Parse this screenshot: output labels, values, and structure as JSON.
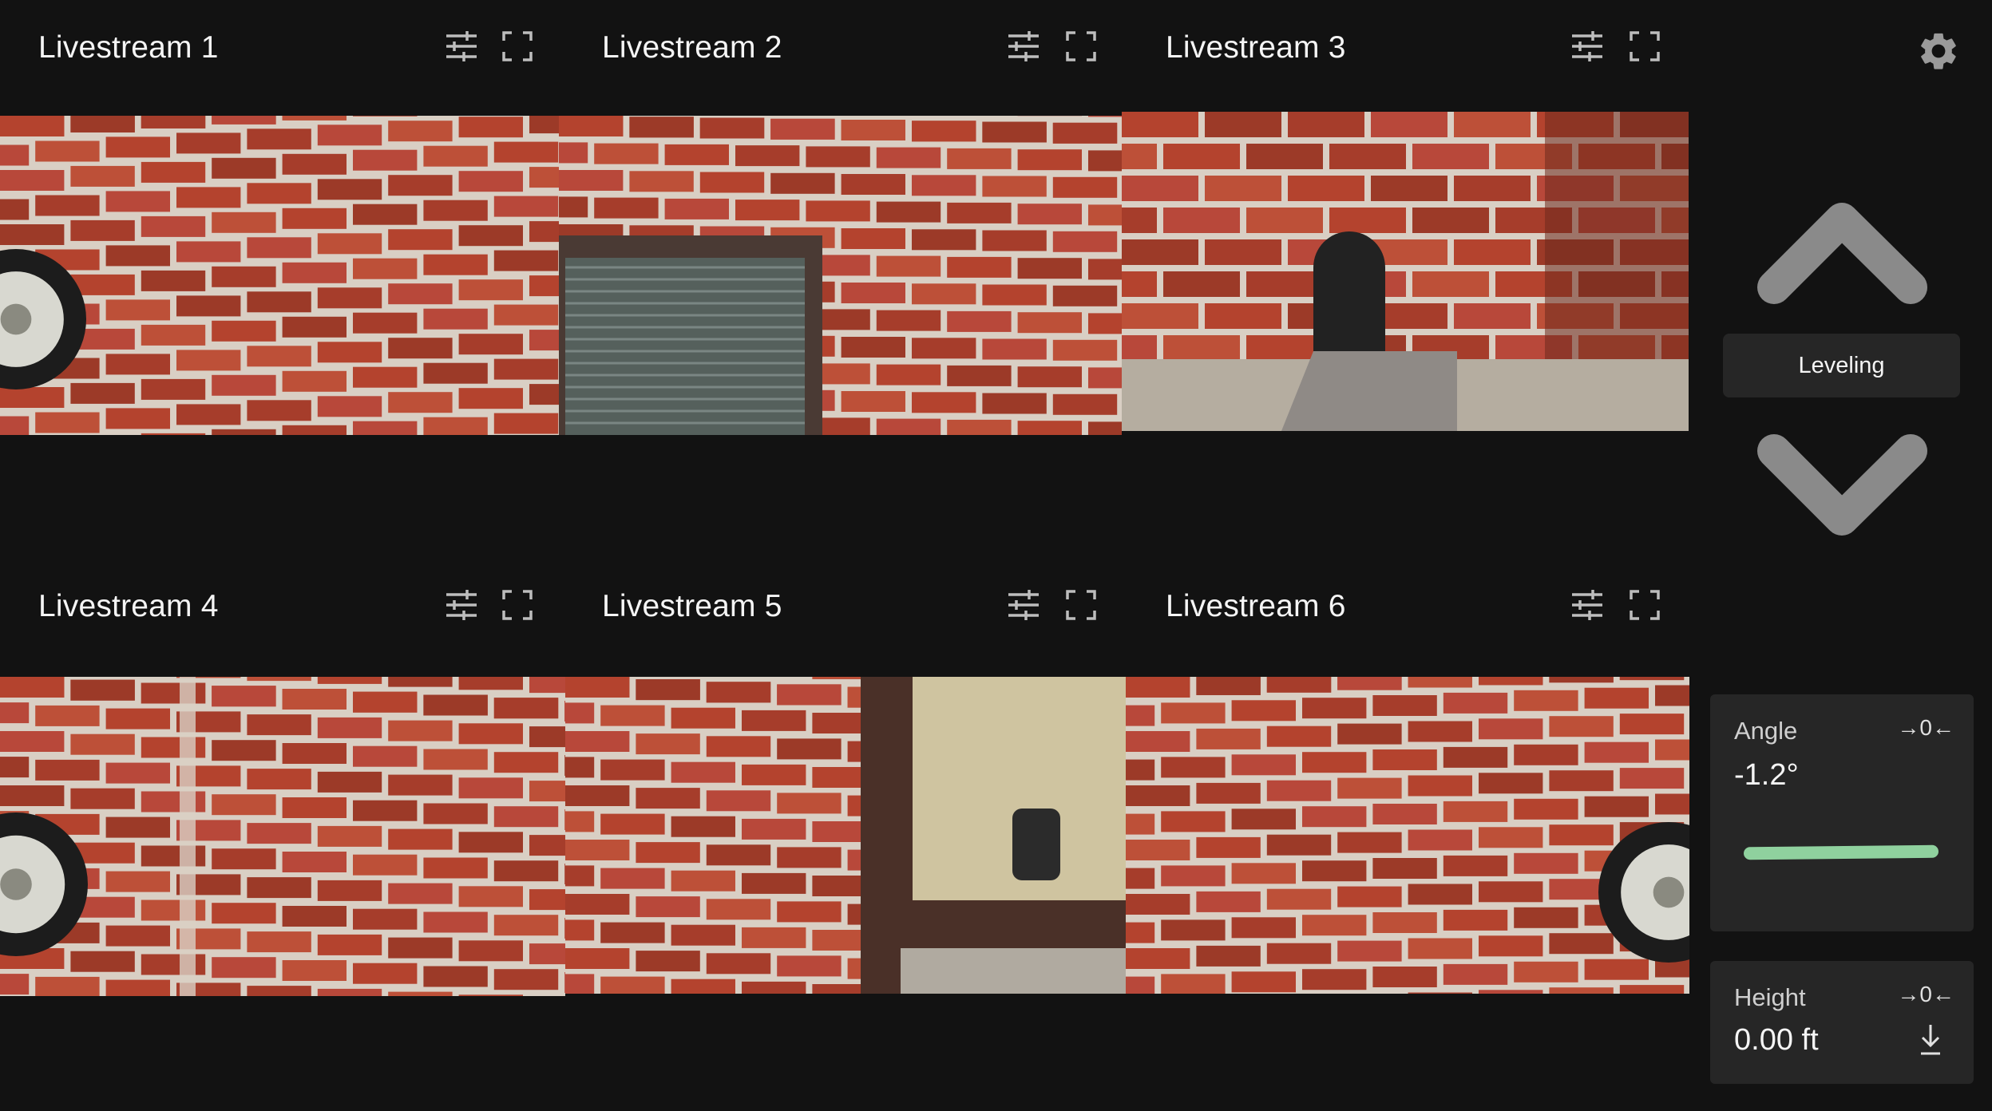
{
  "streams": [
    {
      "title": "Livestream 1",
      "scene": "Brick wall with wheel at left edge"
    },
    {
      "title": "Livestream 2",
      "scene": "Brick wall with window and blinds"
    },
    {
      "title": "Livestream 3",
      "scene": "Brick wall with tire and metal bracket"
    },
    {
      "title": "Livestream 4",
      "scene": "Brick corner with wheel at left edge"
    },
    {
      "title": "Livestream 5",
      "scene": "Brick wall with window reflecting trees"
    },
    {
      "title": "Livestream 6",
      "scene": "Brick wall with wheel at right edge"
    }
  ],
  "stream_icons": {
    "settings": "sliders-icon",
    "fullscreen": "fullscreen-icon"
  },
  "controls": {
    "settings_icon": "gear-icon",
    "up_icon": "chevron-up-icon",
    "down_icon": "chevron-down-icon",
    "leveling_label": "Leveling"
  },
  "angle": {
    "label": "Angle",
    "zero_label": "→0←",
    "value": "-1.2°",
    "level_color": "#8fd19e"
  },
  "height": {
    "label": "Height",
    "zero_label": "→0←",
    "value": "0.00 ft",
    "download_icon": "download-icon"
  },
  "colors": {
    "background": "#121212",
    "panel": "#262626",
    "arrow": "#8a8a8a",
    "brick": "#b04a34",
    "mortar": "#d9cfc4"
  }
}
